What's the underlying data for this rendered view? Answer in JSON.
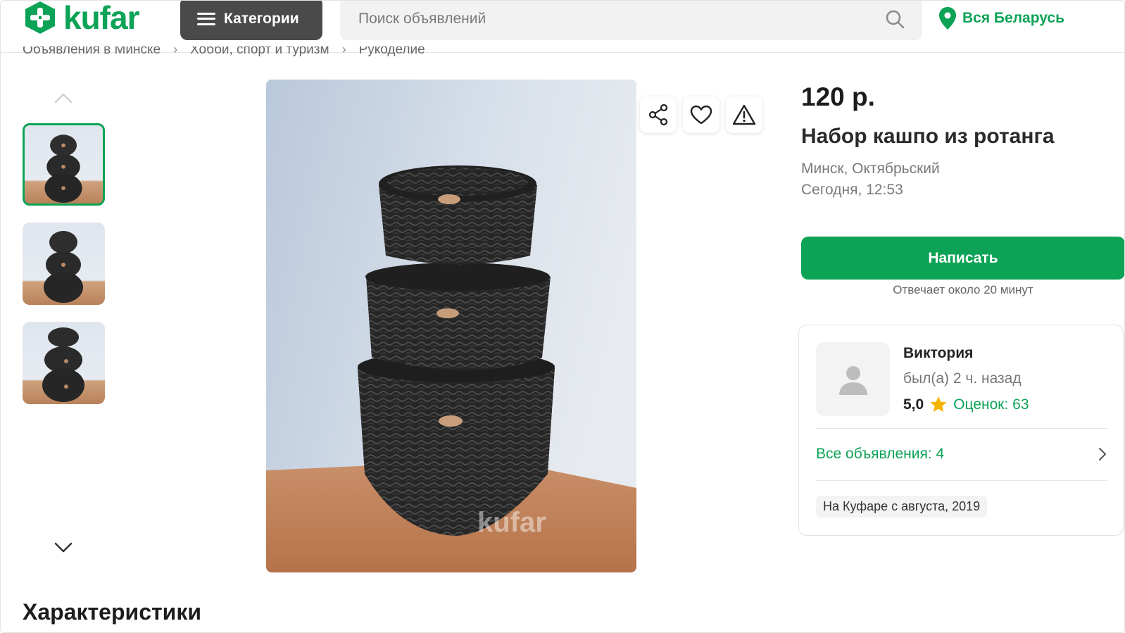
{
  "header": {
    "logo_text": "kufar",
    "categories_label": "Категории",
    "search_placeholder": "Поиск объявлений",
    "region_label": "Вся Беларусь"
  },
  "breadcrumbs": [
    "Объявления в Минске",
    "Хобби, спорт и туризм",
    "Рукоделие"
  ],
  "gallery": {
    "thumbnails": [
      "thumb-1",
      "thumb-2",
      "thumb-3"
    ],
    "active_index": 0,
    "watermark": "kufar"
  },
  "listing": {
    "price": "120 р.",
    "title": "Набор кашпо из ротанга",
    "location": "Минск, Октябрьский",
    "date": "Сегодня, 12:53",
    "write_label": "Написать",
    "reply_time": "Отвечает около 20 минут"
  },
  "seller": {
    "name": "Виктория",
    "last_seen": "был(а) 2 ч. назад",
    "rating": "5,0",
    "reviews": "Оценок: 63",
    "all_ads": "Все объявления: 4",
    "since": "На Куфаре с августа, 2019"
  },
  "sections": {
    "characteristics": "Характеристики"
  },
  "colors": {
    "brand_green": "#0da356",
    "dark_button": "#4a4a4a",
    "star": "#f5b400"
  }
}
